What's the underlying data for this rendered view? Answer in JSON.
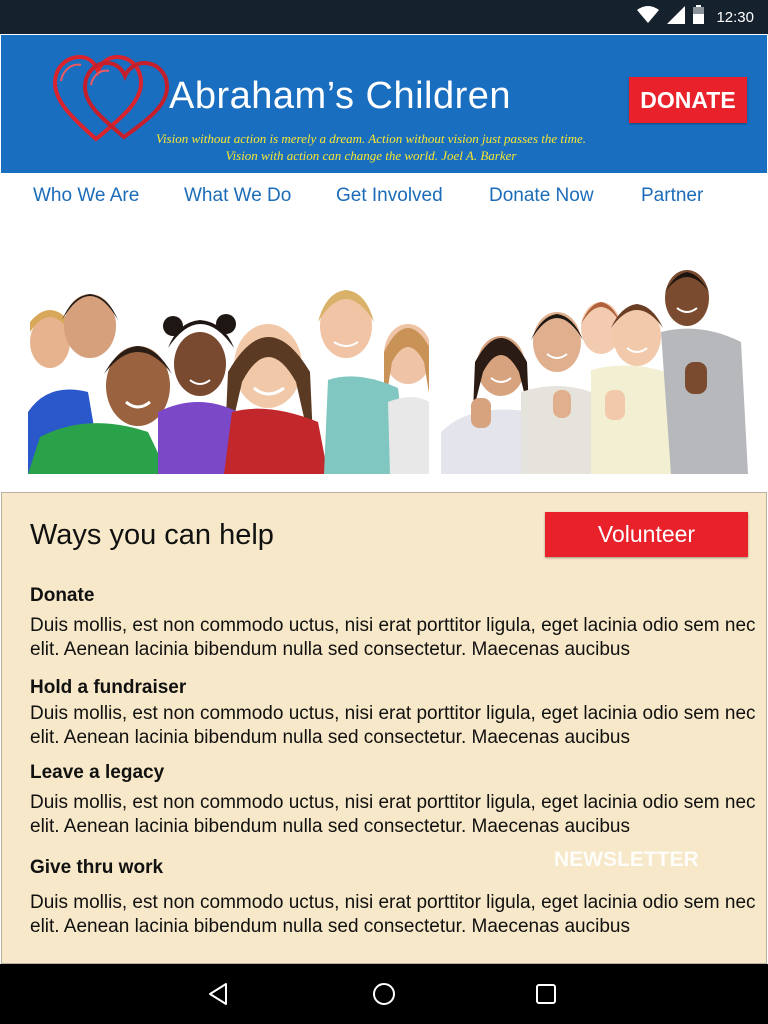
{
  "status_bar": {
    "time": "12:30",
    "icons": [
      "wifi-icon",
      "cellular-signal-icon",
      "battery-icon"
    ]
  },
  "header": {
    "brand": "Abraham’s Children",
    "tagline_line1": "Vision without action is merely a dream. Action without vision just passes the time.",
    "tagline_line2": "Vision with action can change the world.    Joel A. Barker",
    "donate_label": "DONATE",
    "colors": {
      "background": "#1a6ec0",
      "accent": "#e8212a",
      "tagline": "#f7e632"
    }
  },
  "nav": {
    "items": [
      {
        "label": "Who We Are"
      },
      {
        "label": "What We Do"
      },
      {
        "label": "Get Involved"
      },
      {
        "label": "Donate Now"
      },
      {
        "label": "Partner"
      }
    ]
  },
  "ways": {
    "title": "Ways you can help",
    "volunteer_label": "Volunteer",
    "items": [
      {
        "title": "Donate",
        "body": "Duis mollis, est non commodo uctus, nisi erat porttitor ligula, eget lacinia odio sem nec elit. Aenean lacinia bibendum nulla sed consectetur. Maecenas aucibus"
      },
      {
        "title": "Hold a fundraiser",
        "body": "Duis mollis, est non commodo uctus, nisi erat porttitor ligula, eget lacinia odio sem nec elit. Aenean lacinia bibendum nulla sed consectetur. Maecenas aucibus"
      },
      {
        "title": "Leave a legacy",
        "body": "Duis mollis, est non commodo uctus, nisi erat porttitor ligula, eget lacinia odio sem nec elit. Aenean lacinia bibendum nulla sed consectetur. Maecenas aucibus"
      },
      {
        "title": "Give thru work",
        "body": "Duis mollis, est non commodo uctus, nisi erat porttitor ligula, eget lacinia odio sem nec elit. Aenean lacinia bibendum nulla sed consectetur. Maecenas aucibus"
      }
    ],
    "newsletter_label": "NEWSLETTER",
    "colors": {
      "panel": "#f6e8c8"
    }
  },
  "system_nav": {
    "buttons": [
      "back-icon",
      "home-icon",
      "recents-icon"
    ]
  }
}
